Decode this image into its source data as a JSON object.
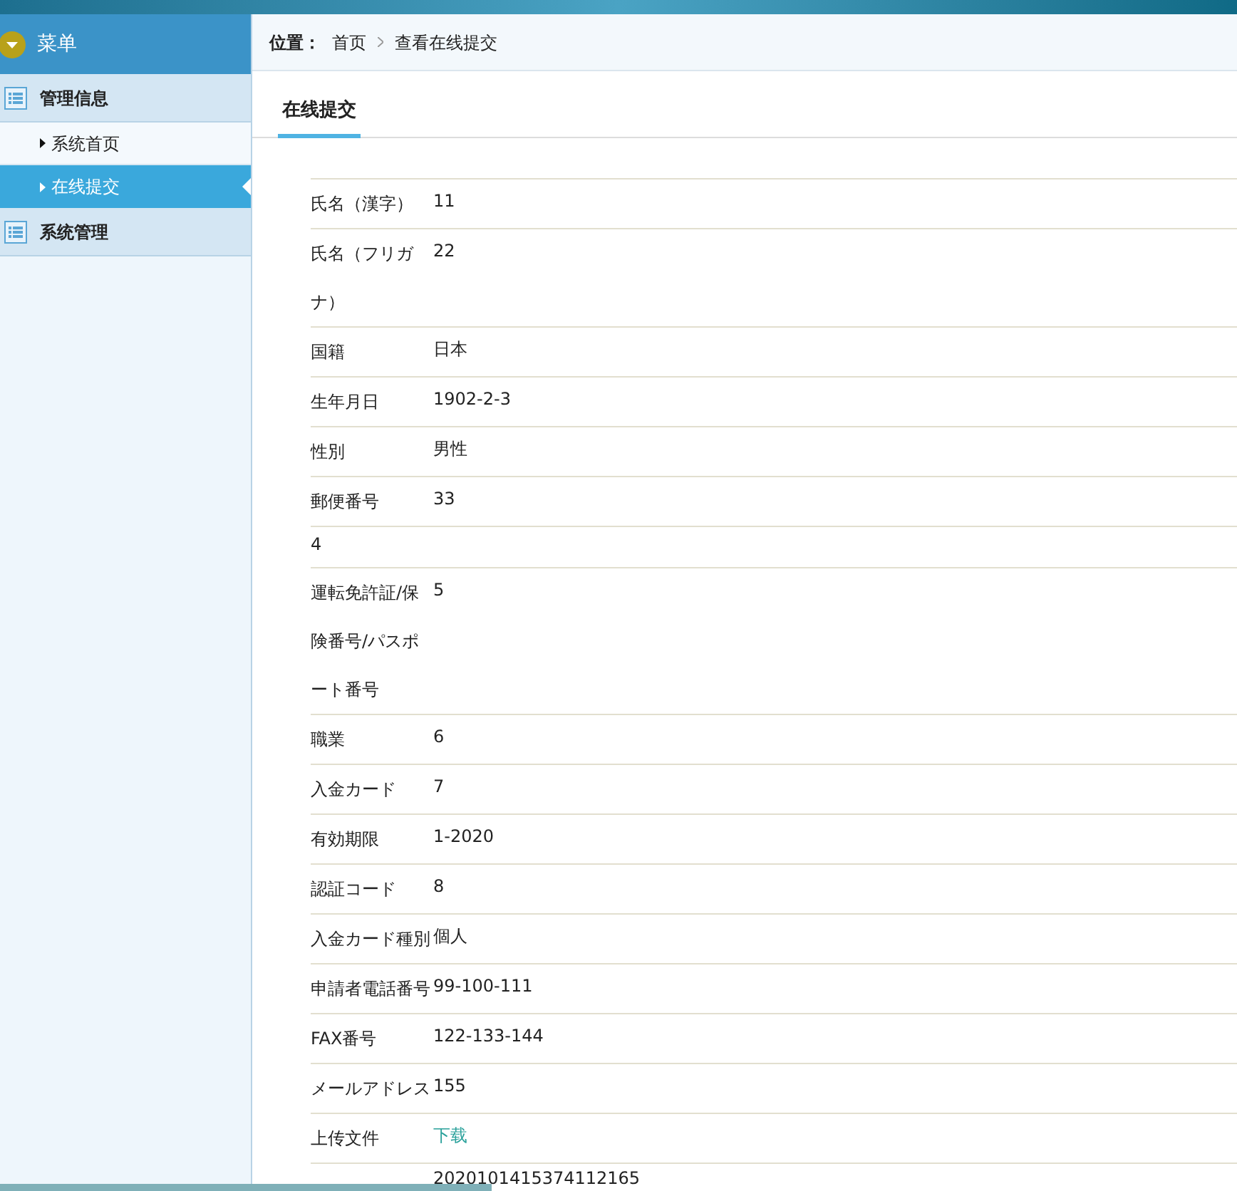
{
  "sidebar": {
    "title": "菜单",
    "groups": [
      {
        "label": "管理信息",
        "items": [
          {
            "label": "系统首页",
            "selected": false
          },
          {
            "label": "在线提交",
            "selected": true
          }
        ]
      },
      {
        "label": "系统管理"
      }
    ]
  },
  "breadcrumb": {
    "label": "位置：",
    "items": [
      "首页",
      "查看在线提交"
    ]
  },
  "tab": {
    "label": "在线提交"
  },
  "rows": [
    {
      "label": "氏名（漢字）",
      "value": "11"
    },
    {
      "label": "氏名（フリガナ）",
      "value": "22"
    },
    {
      "label": "国籍",
      "value": "日本"
    },
    {
      "label": "生年月日",
      "value": "1902-2-3"
    },
    {
      "label": "性別",
      "value": "男性"
    },
    {
      "label": "郵便番号",
      "value": "33"
    },
    {
      "label": "4"
    },
    {
      "label": "運転免許証/保険番号/パスポート番号",
      "value": "5"
    },
    {
      "label": "職業",
      "value": "6"
    },
    {
      "label": "入金カード",
      "value": "7"
    },
    {
      "label": "有効期限",
      "value": "1-2020"
    },
    {
      "label": "認証コード",
      "value": "8"
    },
    {
      "label": "入金カード種別",
      "value": "個人"
    },
    {
      "label": "申請者電話番号",
      "value": "99-100-111"
    },
    {
      "label": "FAX番号",
      "value": "122-133-144"
    },
    {
      "label": "メールアドレス",
      "value": "155"
    },
    {
      "label": "上传文件",
      "value": "下载",
      "kind": "link"
    },
    {
      "value": "2020101415374112165"
    }
  ]
}
